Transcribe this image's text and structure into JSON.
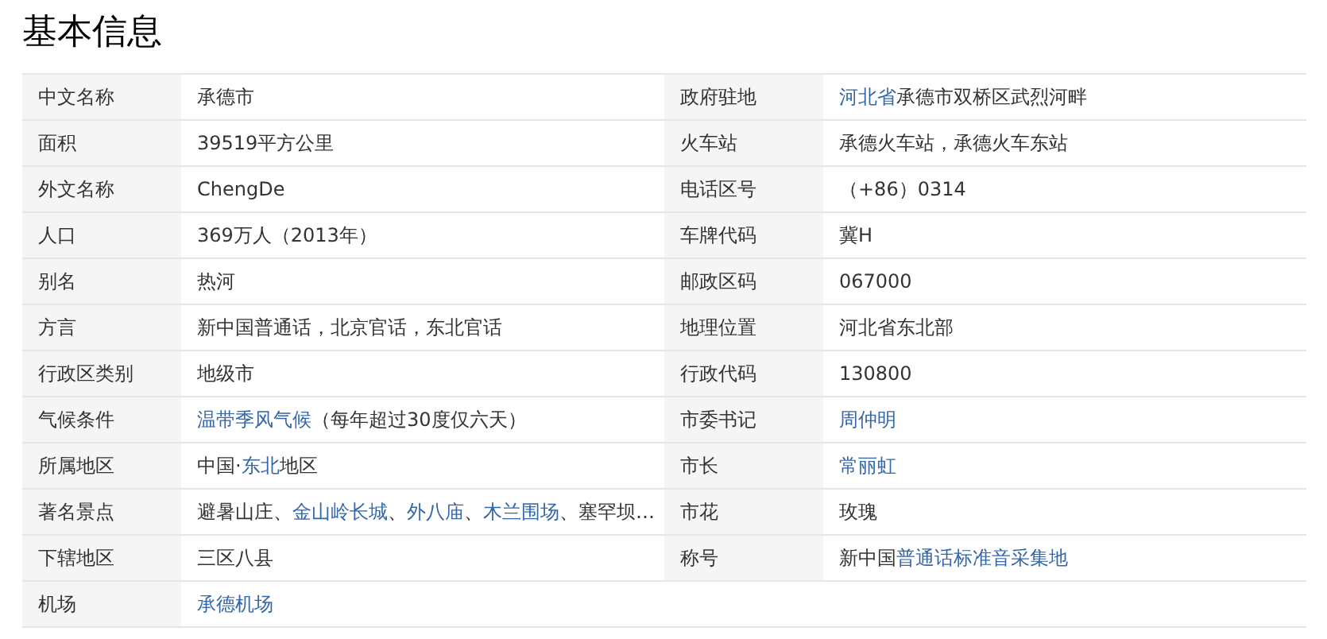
{
  "title": "基本信息",
  "rows": [
    {
      "left": {
        "label": "中文名称",
        "value": [
          {
            "text": "承德市",
            "link": false
          }
        ]
      },
      "right": {
        "label": "政府驻地",
        "value": [
          {
            "text": "河北省",
            "link": true
          },
          {
            "text": "承德市双桥区武烈河畔",
            "link": false
          }
        ]
      }
    },
    {
      "left": {
        "label": "面积",
        "value": [
          {
            "text": "39519平方公里",
            "link": false
          }
        ]
      },
      "right": {
        "label": "火车站",
        "value": [
          {
            "text": "承德火车站，承德火车东站",
            "link": false
          }
        ]
      }
    },
    {
      "left": {
        "label": "外文名称",
        "value": [
          {
            "text": "ChengDe",
            "link": false
          }
        ]
      },
      "right": {
        "label": "电话区号",
        "value": [
          {
            "text": "（+86）0314",
            "link": false
          }
        ]
      }
    },
    {
      "left": {
        "label": "人口",
        "value": [
          {
            "text": "369万人（2013年）",
            "link": false
          }
        ]
      },
      "right": {
        "label": "车牌代码",
        "value": [
          {
            "text": "冀H",
            "link": false
          }
        ]
      }
    },
    {
      "left": {
        "label": "别名",
        "value": [
          {
            "text": "热河",
            "link": false
          }
        ]
      },
      "right": {
        "label": "邮政区码",
        "value": [
          {
            "text": "067000",
            "link": false
          }
        ]
      }
    },
    {
      "left": {
        "label": "方言",
        "value": [
          {
            "text": "新中国普通话，北京官话，东北官话",
            "link": false
          }
        ]
      },
      "right": {
        "label": "地理位置",
        "value": [
          {
            "text": "河北省东北部",
            "link": false
          }
        ]
      }
    },
    {
      "left": {
        "label": "行政区类别",
        "value": [
          {
            "text": "地级市",
            "link": false
          }
        ]
      },
      "right": {
        "label": "行政代码",
        "value": [
          {
            "text": "130800",
            "link": false
          }
        ]
      }
    },
    {
      "left": {
        "label": "气候条件",
        "value": [
          {
            "text": "温带季风气候",
            "link": true
          },
          {
            "text": "（每年超过30度仅六天）",
            "link": false
          }
        ]
      },
      "right": {
        "label": "市委书记",
        "value": [
          {
            "text": "周仲明",
            "link": true
          }
        ]
      }
    },
    {
      "left": {
        "label": "所属地区",
        "value": [
          {
            "text": "中国·",
            "link": false
          },
          {
            "text": "东北",
            "link": true
          },
          {
            "text": "地区",
            "link": false
          }
        ]
      },
      "right": {
        "label": "市长",
        "value": [
          {
            "text": "常丽虹",
            "link": true
          }
        ]
      }
    },
    {
      "left": {
        "label": "著名景点",
        "value": [
          {
            "text": "避暑山庄、",
            "link": false
          },
          {
            "text": "金山岭长城",
            "link": true
          },
          {
            "text": "、",
            "link": false
          },
          {
            "text": "外八庙",
            "link": true
          },
          {
            "text": "、",
            "link": false
          },
          {
            "text": "木兰围场",
            "link": true
          },
          {
            "text": "、塞罕坝…",
            "link": false
          }
        ]
      },
      "right": {
        "label": "市花",
        "value": [
          {
            "text": "玫瑰",
            "link": false
          }
        ]
      }
    },
    {
      "left": {
        "label": "下辖地区",
        "value": [
          {
            "text": "三区八县",
            "link": false
          }
        ]
      },
      "right": {
        "label": "称号",
        "value": [
          {
            "text": "新中国",
            "link": false
          },
          {
            "text": "普通话标准音采集地",
            "link": true
          }
        ]
      }
    },
    {
      "left": {
        "label": "机场",
        "value": [
          {
            "text": "承德机场",
            "link": true
          }
        ]
      }
    }
  ]
}
